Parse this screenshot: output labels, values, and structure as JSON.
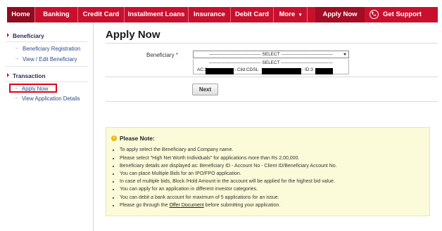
{
  "nav": {
    "items": [
      {
        "label": "Home"
      },
      {
        "label": "Banking"
      },
      {
        "label": "Credit Card"
      },
      {
        "label": "Installment Loans"
      },
      {
        "label": "Insurance"
      },
      {
        "label": "Debit Card"
      },
      {
        "label": "More"
      }
    ],
    "more_caret": "▾",
    "apply_now": "Apply Now",
    "get_support": "Get Support",
    "accent": "#c8102e"
  },
  "sidebar": {
    "section1": "Beneficiary",
    "section1_items": [
      "Beneficiary Registration",
      "View / Edit Beneficiary"
    ],
    "section2": "Transaction",
    "section2_items": [
      "Apply Now",
      "View Application Details"
    ]
  },
  "main": {
    "title": "Apply Now",
    "beneficiary_label": "Beneficiary",
    "required_mark": "*",
    "select_value": "---------------------------------- SELECT ----------------------------------",
    "options": [
      "---------------------------------- SELECT ----------------------------------",
      "AC:3",
      "- Cild:CDSL",
      "- ID:3"
    ],
    "next_button": "Next"
  },
  "note": {
    "title": "Please Note:",
    "items": [
      "To apply select the Beneficiary and Company name.",
      "Please select \"High Net Worth Individuals\" for applications more than Rs 2,00,000.",
      "Beneficiary details are displayed as: Beneficiary ID - Account No - Client ID/Beneficiary Account No.",
      "You can place Multiple Bids for an IPO/FPO application.",
      "In case of multiple bids, Block /Hold Amount in the account will be applied for the highest bid value.",
      "You can apply for an application in different investor categories.",
      "You can debit a bank account for maximum of 5 applications for an issue."
    ],
    "last_item_prefix": "Please go through the ",
    "last_item_link": "Offer Document",
    "last_item_suffix": " before submitting your application."
  }
}
